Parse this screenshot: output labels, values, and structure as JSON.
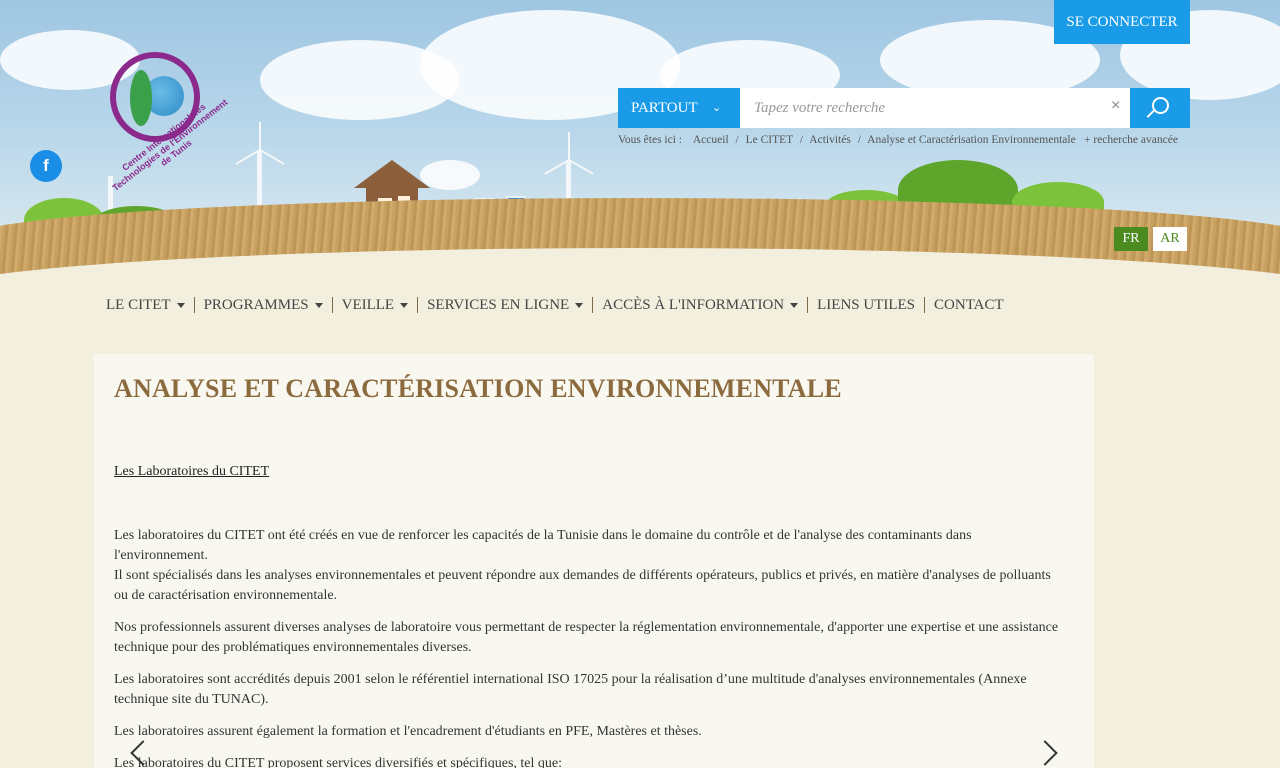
{
  "header": {
    "connect_label": "SE CONNECTER",
    "facebook_glyph": "f",
    "logo_text": "Centre International des Technologies de l'Environnement de Tunis"
  },
  "search": {
    "scope_label": "PARTOUT",
    "placeholder": "Tapez votre recherche",
    "clear_glyph": "×",
    "advanced_label": "+   recherche avancée"
  },
  "breadcrumb": {
    "prefix": "Vous êtes ici :",
    "items": [
      "Accueil",
      "Le CITET",
      "Activités",
      "Analyse et Caractérisation Environnementale"
    ]
  },
  "languages": {
    "fr": "FR",
    "ar": "AR"
  },
  "nav": {
    "items": [
      {
        "label": "LE CITET"
      },
      {
        "label": "PROGRAMMES"
      },
      {
        "label": "VEILLE"
      },
      {
        "label": "SERVICES EN LIGNE"
      },
      {
        "label": "ACCÈS À L'INFORMATION"
      },
      {
        "label": "LIENS UTILES"
      },
      {
        "label": "CONTACT"
      }
    ]
  },
  "content": {
    "title": "ANALYSE ET CARACTÉRISATION ENVIRONNEMENTALE",
    "subtitle": "Les Laboratoires du CITET",
    "p1": "Les laboratoires du CITET ont été créés en vue de renforcer les capacités de la Tunisie dans le domaine du contrôle et de l'analyse des contaminants dans l'environnement.",
    "p1b": "Il sont spécialisés dans les analyses environnementales et peuvent répondre aux demandes de différents opérateurs, publics et privés, en matière d'analyses de polluants ou de caractérisation environnementale.",
    "p2": "Nos professionnels assurent diverses analyses de laboratoire vous permettant de respecter la réglementation environnementale, d'apporter une expertise et une assistance technique pour des problématiques environnementales diverses.",
    "p3": "Les laboratoires sont accrédités depuis 2001 selon le référentiel international ISO 17025 pour la réalisation d’une multitude d'analyses environnementales (Annexe technique site du TUNAC).",
    "p4": "Les laboratoires assurent également la formation et l'encadrement d'étudiants en PFE, Mastères et thèses.",
    "p5": "Les laboratoires du CITET proposent services diversifiés et spécifiques, tel que:"
  }
}
